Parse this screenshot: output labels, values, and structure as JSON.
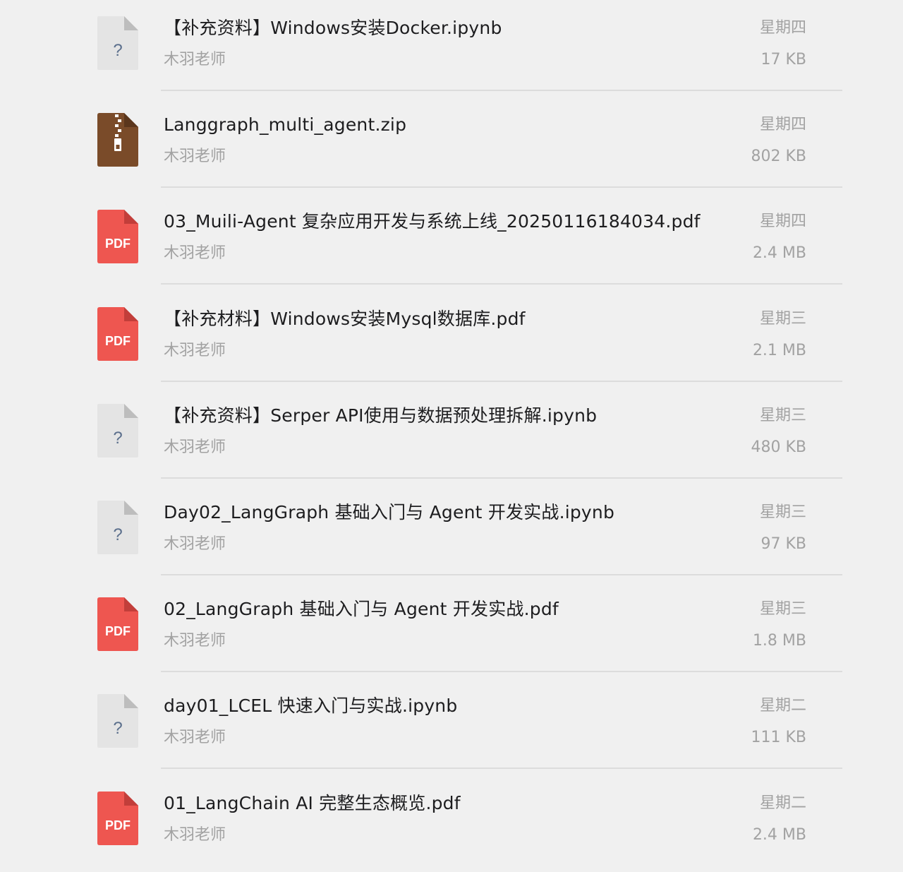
{
  "files": [
    {
      "name": "【补充资料】Windows安装Docker.ipynb",
      "owner": "木羽老师",
      "date": "星期四",
      "size": "17 KB",
      "icon": "unknown-file-icon",
      "icon_text": "?"
    },
    {
      "name": "Langgraph_multi_agent.zip",
      "owner": "木羽老师",
      "date": "星期四",
      "size": "802 KB",
      "icon": "zip-archive-icon",
      "icon_text": ""
    },
    {
      "name": "03_Muili-Agent 复杂应用开发与系统上线_20250116184034.pdf",
      "owner": "木羽老师",
      "date": "星期四",
      "size": "2.4 MB",
      "icon": "pdf-file-icon",
      "icon_text": "PDF"
    },
    {
      "name": "【补充材料】Windows安装Mysql数据库.pdf",
      "owner": "木羽老师",
      "date": "星期三",
      "size": "2.1 MB",
      "icon": "pdf-file-icon",
      "icon_text": "PDF"
    },
    {
      "name": "【补充资料】Serper API使用与数据预处理拆解.ipynb",
      "owner": "木羽老师",
      "date": "星期三",
      "size": "480 KB",
      "icon": "unknown-file-icon",
      "icon_text": "?"
    },
    {
      "name": "Day02_LangGraph 基础入门与 Agent 开发实战.ipynb",
      "owner": "木羽老师",
      "date": "星期三",
      "size": "97 KB",
      "icon": "unknown-file-icon",
      "icon_text": "?"
    },
    {
      "name": "02_LangGraph 基础入门与 Agent 开发实战.pdf",
      "owner": "木羽老师",
      "date": "星期三",
      "size": "1.8 MB",
      "icon": "pdf-file-icon",
      "icon_text": "PDF"
    },
    {
      "name": "day01_LCEL 快速入门与实战.ipynb",
      "owner": "木羽老师",
      "date": "星期二",
      "size": "111 KB",
      "icon": "unknown-file-icon",
      "icon_text": "?"
    },
    {
      "name": "01_LangChain AI 完整生态概览.pdf",
      "owner": "木羽老师",
      "date": "星期二",
      "size": "2.4 MB",
      "icon": "pdf-file-icon",
      "icon_text": "PDF"
    }
  ],
  "colors": {
    "background": "#f0f0f0",
    "pdf_red": "#ee5650",
    "pdf_fold": "#c23e3a",
    "zip_brown": "#7a4b29",
    "unknown_gray": "#e4e4e4",
    "unknown_fold": "#bdbdbd",
    "unknown_mark": "#5b6f8c",
    "divider": "#dcdcdc",
    "primary_text": "#1d1d1f",
    "secondary_text": "#a2a2a2"
  }
}
